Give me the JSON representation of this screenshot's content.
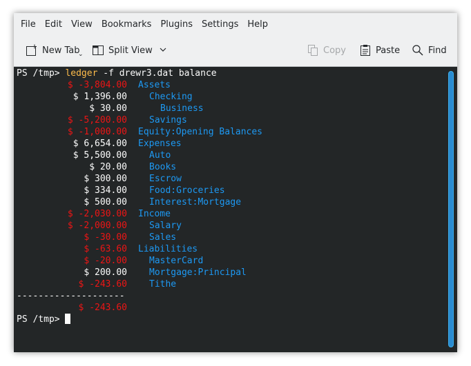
{
  "menubar": {
    "items": [
      "File",
      "Edit",
      "View",
      "Bookmarks",
      "Plugins",
      "Settings",
      "Help"
    ]
  },
  "toolbar": {
    "new_tab": "New Tab",
    "split_view": "Split View",
    "copy": "Copy",
    "paste": "Paste",
    "find": "Find"
  },
  "terminal": {
    "prompt": "PS /tmp> ",
    "command": {
      "program": "ledger",
      "args": " -f drewr3.dat balance"
    },
    "rows": [
      {
        "amount": "$ -3,804.00",
        "neg": true,
        "indent": 0,
        "account": "Assets"
      },
      {
        "amount": "$ 1,396.00",
        "neg": false,
        "indent": 1,
        "account": "Checking"
      },
      {
        "amount": "$ 30.00",
        "neg": false,
        "indent": 2,
        "account": "Business"
      },
      {
        "amount": "$ -5,200.00",
        "neg": true,
        "indent": 1,
        "account": "Savings"
      },
      {
        "amount": "$ -1,000.00",
        "neg": true,
        "indent": 0,
        "account": "Equity:Opening Balances"
      },
      {
        "amount": "$ 6,654.00",
        "neg": false,
        "indent": 0,
        "account": "Expenses"
      },
      {
        "amount": "$ 5,500.00",
        "neg": false,
        "indent": 1,
        "account": "Auto"
      },
      {
        "amount": "$ 20.00",
        "neg": false,
        "indent": 1,
        "account": "Books"
      },
      {
        "amount": "$ 300.00",
        "neg": false,
        "indent": 1,
        "account": "Escrow"
      },
      {
        "amount": "$ 334.00",
        "neg": false,
        "indent": 1,
        "account": "Food:Groceries"
      },
      {
        "amount": "$ 500.00",
        "neg": false,
        "indent": 1,
        "account": "Interest:Mortgage"
      },
      {
        "amount": "$ -2,030.00",
        "neg": true,
        "indent": 0,
        "account": "Income"
      },
      {
        "amount": "$ -2,000.00",
        "neg": true,
        "indent": 1,
        "account": "Salary"
      },
      {
        "amount": "$ -30.00",
        "neg": true,
        "indent": 1,
        "account": "Sales"
      },
      {
        "amount": "$ -63.60",
        "neg": true,
        "indent": 0,
        "account": "Liabilities"
      },
      {
        "amount": "$ -20.00",
        "neg": true,
        "indent": 1,
        "account": "MasterCard"
      },
      {
        "amount": "$ 200.00",
        "neg": false,
        "indent": 1,
        "account": "Mortgage:Principal"
      },
      {
        "amount": "$ -243.60",
        "neg": true,
        "indent": 1,
        "account": "Tithe"
      }
    ],
    "separator": "--------------------",
    "total": {
      "amount": "$ -243.60",
      "neg": true
    },
    "colors": {
      "background": "#232627",
      "foreground": "#fcfcfc",
      "account": "#1d99f3",
      "negative": "#ed1515",
      "command": "#fdbc4b",
      "scrollbar": "#2a8bd1"
    }
  }
}
